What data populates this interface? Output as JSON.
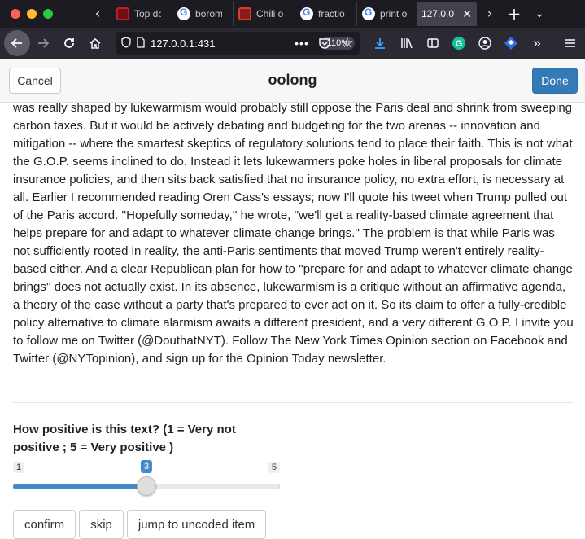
{
  "browser": {
    "tabs": [
      {
        "label": "Top do",
        "favicon": "red-square-icon"
      },
      {
        "label": "borom",
        "favicon": "google-icon"
      },
      {
        "label": "Chili o",
        "favicon": "chili-icon"
      },
      {
        "label": "fractio",
        "favicon": "google-icon"
      },
      {
        "label": "print o",
        "favicon": "google-icon"
      },
      {
        "label": "127.0.0",
        "favicon": "",
        "active": true
      }
    ],
    "url": "127.0.0.1:431",
    "zoom": "110%"
  },
  "header": {
    "cancel_label": "Cancel",
    "title": "oolong",
    "done_label": "Done"
  },
  "body_text": "was really shaped by lukewarmism would probably still oppose the Paris deal and shrink from sweeping carbon taxes. But it would be actively debating and budgeting for the two arenas -- innovation and mitigation -- where the smartest skeptics of regulatory solutions tend to place their faith. This is not what the G.O.P. seems inclined to do. Instead it lets lukewarmers poke holes in liberal proposals for climate insurance policies, and then sits back satisfied that no insurance policy, no extra effort, is necessary at all. Earlier I recommended reading Oren Cass's essays; now I'll quote his tweet when Trump pulled out of the Paris accord. ''Hopefully someday,'' he wrote, ''we'll get a reality-based climate agreement that helps prepare for and adapt to whatever climate change brings.'' The problem is that while Paris was not sufficiently rooted in reality, the anti-Paris sentiments that moved Trump weren't entirely reality-based either. And a clear Republican plan for how to ''prepare for and adapt to whatever climate change brings'' does not actually exist. In its absence, lukewarmism is a critique without an affirmative agenda, a theory of the case without a party that's prepared to ever act on it. So its claim to offer a fully-credible policy alternative to climate alarmism awaits a different president, and a very different G.O.P. I invite you to follow me on Twitter (@DouthatNYT). Follow The New York Times Opinion section on Facebook and Twitter (@NYTopinion), and sign up for the Opinion Today newsletter.",
  "question": "How positive is this text? (1 = Very not positive ; 5 = Very positive )",
  "slider": {
    "min": 1,
    "max": 5,
    "value": 3,
    "min_label": "1",
    "max_label": "5",
    "value_label": "3"
  },
  "actions": {
    "confirm_label": "confirm",
    "skip_label": "skip",
    "jump_label": "jump to uncoded item"
  },
  "colors": {
    "primary": "#337ab7",
    "slider_fill": "#428bca"
  }
}
